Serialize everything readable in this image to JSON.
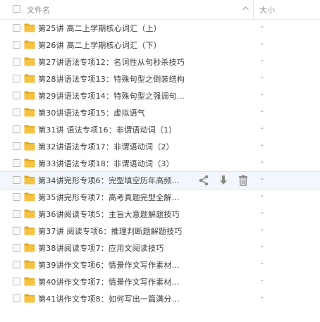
{
  "header": {
    "name_label": "文件名",
    "size_label": "大小",
    "sort_icon": "chevron-up-icon"
  },
  "colors": {
    "folder": "#f5c242",
    "folder_dark": "#e0a81f",
    "action_icon": "#8a8a8a",
    "hover_bg": "#f2f7fd"
  },
  "files": [
    {
      "name": "第25讲 高二上学期核心词汇（上）",
      "size": "-"
    },
    {
      "name": "第26讲 高二上学期核心词汇（下）",
      "size": "-"
    },
    {
      "name": "第27讲语法专项12：名词性从句秒杀技巧",
      "size": "-"
    },
    {
      "name": "第28讲语法专项13：特殊句型之倒装结构",
      "size": "-"
    },
    {
      "name": "第29讲语法专项14：特殊句型之强调句...",
      "size": "-"
    },
    {
      "name": "第30讲语法专项15：虚拟语气",
      "size": "-"
    },
    {
      "name": "第31讲 语法专项16：非谓语动词（1）",
      "size": "-"
    },
    {
      "name": "第32讲语法专项17：非谓语动词（2）",
      "size": "-"
    },
    {
      "name": "第33讲语法专项18：非谓语动词（3）",
      "size": "-"
    },
    {
      "name": "第34讲完形专项6：完型填空历年高频...",
      "size": "-",
      "hover": true
    },
    {
      "name": "第35讲完形专项7：高考真题完型全解...",
      "size": "-"
    },
    {
      "name": "第36讲阅读专项5：主旨大意题解题技巧",
      "size": "-"
    },
    {
      "name": "第37讲 阅读专项6：推理判断题解题技巧",
      "size": "-"
    },
    {
      "name": "第38讲阅读专项7：应用文阅读技巧",
      "size": "-"
    },
    {
      "name": "第39讲作文专项6：情景作文写作素材...",
      "size": "-"
    },
    {
      "name": "第40讲作文专项7：情景作文写作素材...",
      "size": "-"
    },
    {
      "name": "第41讲作文专项8：如何写出一篇满分...",
      "size": "-"
    }
  ],
  "row_actions": [
    "share-icon",
    "download-icon",
    "delete-icon"
  ]
}
